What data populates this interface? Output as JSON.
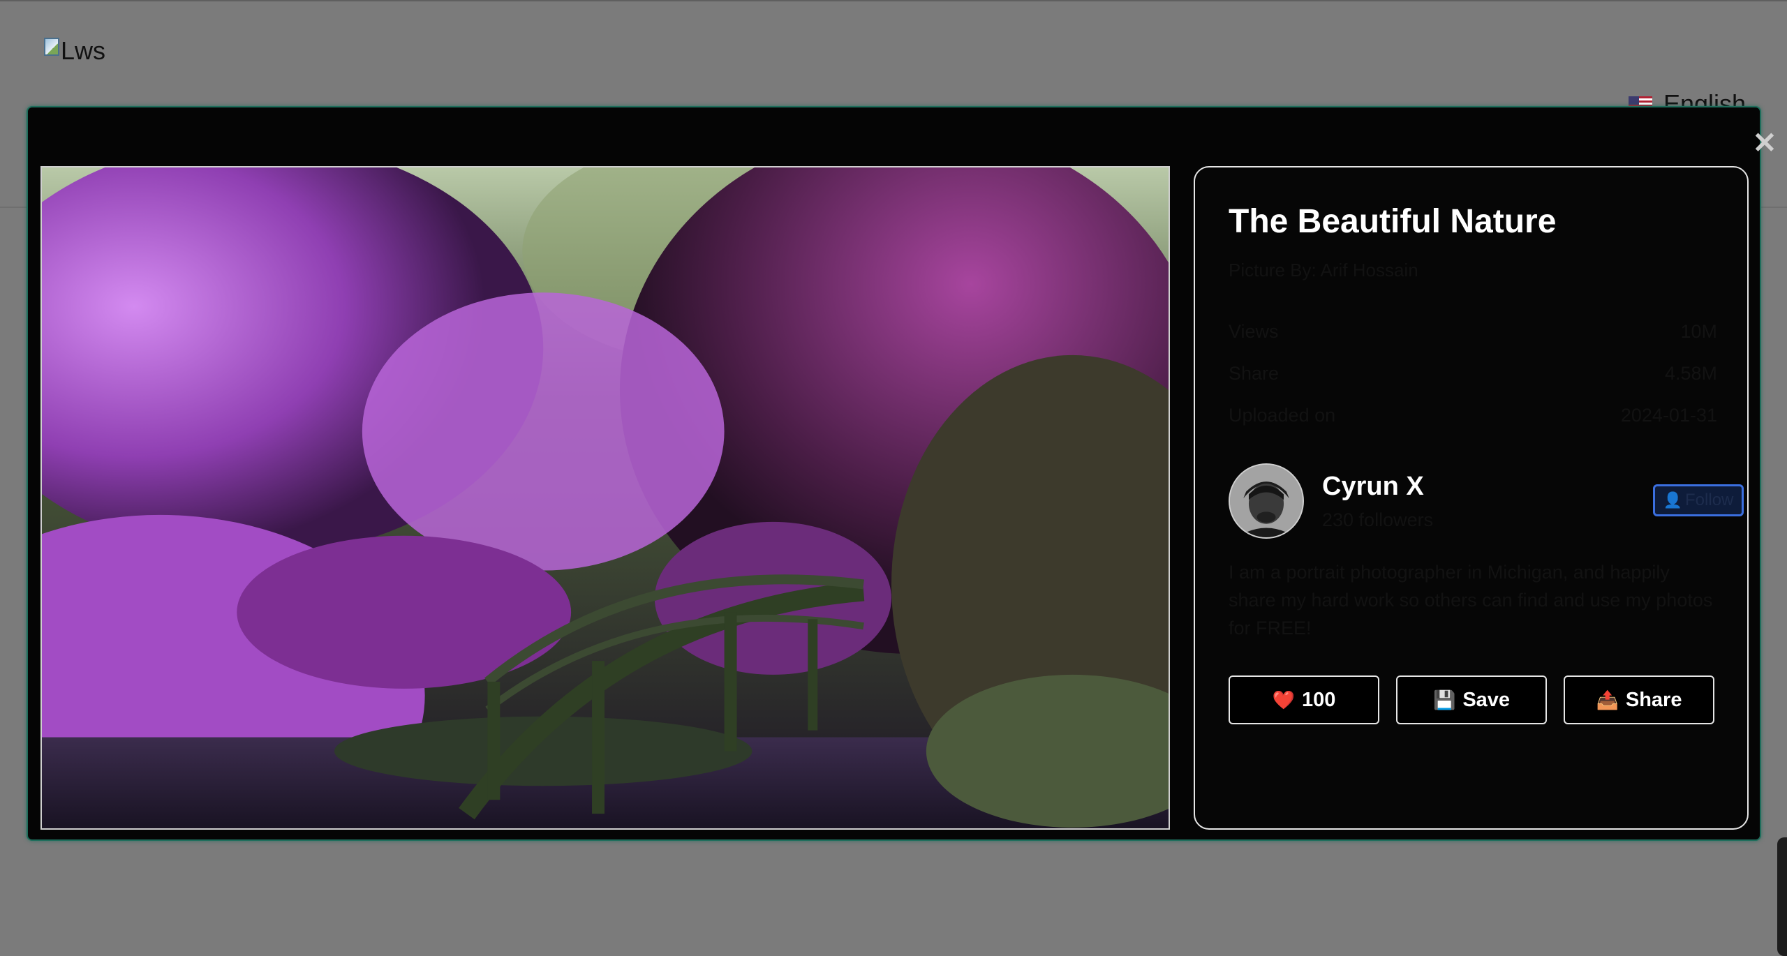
{
  "header": {
    "logo_alt": "Lws",
    "language": "English"
  },
  "modal": {
    "close_symbol": "✕",
    "image": {
      "description_icon": "photo"
    },
    "details": {
      "title": "The Beautiful Nature",
      "subtitle": "Picture By: Arif Hossain",
      "stats": [
        {
          "label": "Views",
          "value": "10M"
        },
        {
          "label": "Share",
          "value": "4.58M"
        },
        {
          "label": "Uploaded on",
          "value": "2024-01-31"
        }
      ],
      "author": {
        "name": "Cyrun X",
        "followers": "230 followers",
        "follow_label": "Follow",
        "follow_icon": "👤"
      },
      "bio": "I am a portrait photographer in Michigan, and happily share my hard work so others can find and use my photos for FREE!",
      "actions": {
        "like_icon": "❤️",
        "like_count": "100",
        "save_icon": "💾",
        "save_label": "Save",
        "share_icon": "📤",
        "share_label": "Share"
      }
    }
  },
  "colors": {
    "backdrop": "#7b7b7b",
    "modal_bg": "#050505",
    "modal_border": "#1f6e5c",
    "follow_focus": "#3b6fe0"
  }
}
